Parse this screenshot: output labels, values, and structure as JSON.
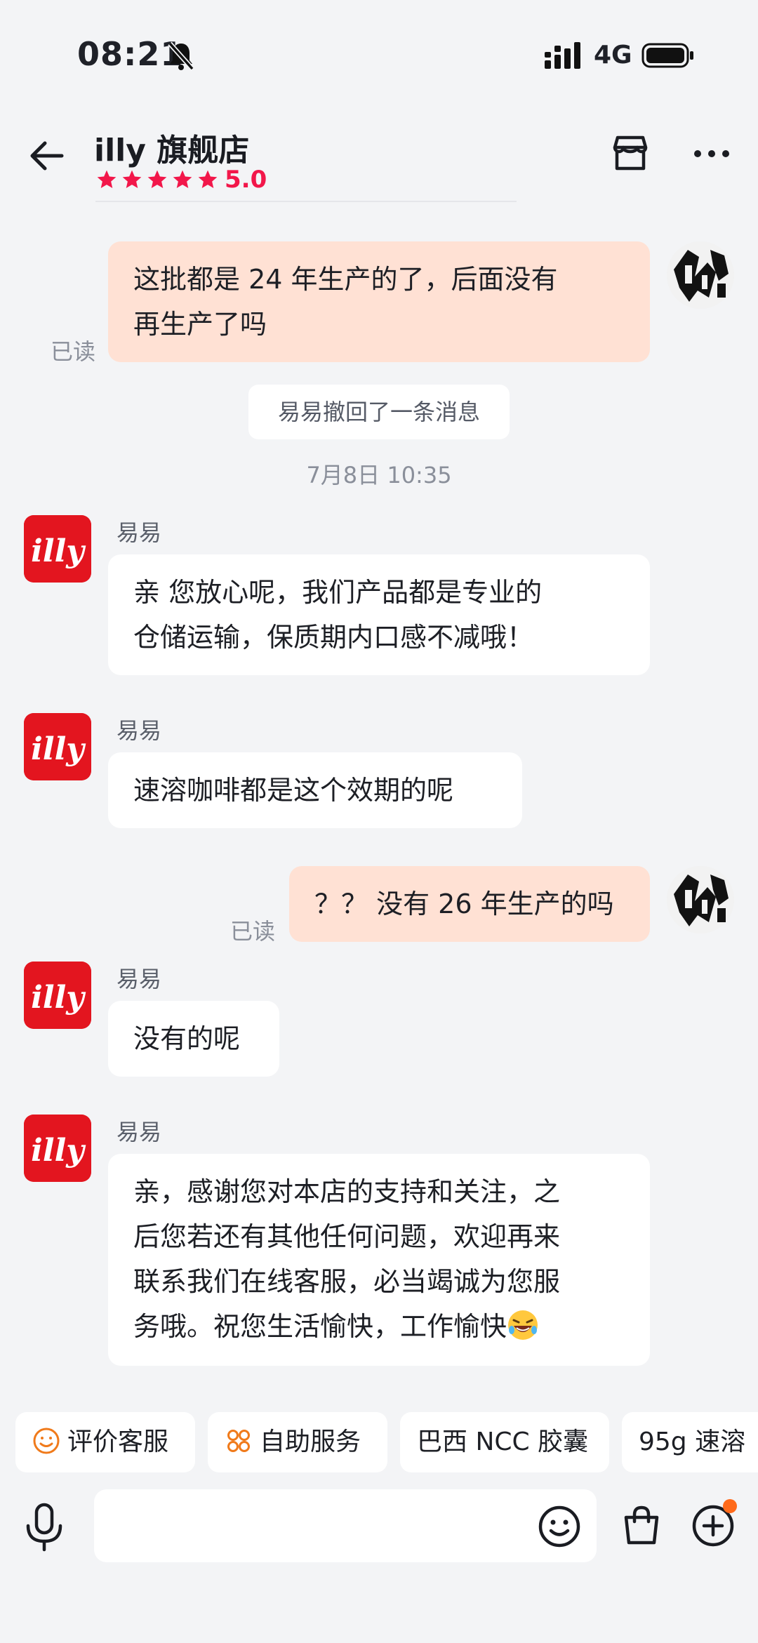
{
  "status_bar": {
    "time": "08:21",
    "network": "4G"
  },
  "header": {
    "shop_name": "illy 旗舰店",
    "rating": "5.0"
  },
  "messages": [
    {
      "read": "已读",
      "text_line1": "这批都是 24 年生产的了，后面没有",
      "text_line2": "再生产了吗"
    },
    {
      "system": "易易撤回了一条消息"
    },
    {
      "timestamp": "7月8日 10:35"
    },
    {
      "sender": "易易",
      "text_line1": "亲 您放心呢，我们产品都是专业的",
      "text_line2": "仓储运输，保质期内口感不减哦！"
    },
    {
      "sender": "易易",
      "text": "速溶咖啡都是这个效期的呢"
    },
    {
      "read": "已读",
      "text": "？？ 没有 26 年生产的吗"
    },
    {
      "sender": "易易",
      "text": "没有的呢"
    },
    {
      "sender": "易易",
      "text_line1": "亲，感谢您对本店的支持和关注，之",
      "text_line2": "后您若还有其他任何问题，欢迎再来",
      "text_line3": "联系我们在线客服，必当竭诚为您服",
      "text_line4": "务哦。祝您生活愉快，工作愉快"
    }
  ],
  "quick_chips": [
    "评价客服",
    "自助服务",
    "巴西 NCC 胶囊",
    "95g 速溶"
  ],
  "shop_logo_text": "illy",
  "colors": {
    "accent": "#f2174a",
    "my_bubble": "#ffe1d4",
    "brand_red": "#e3151f",
    "badge": "#ff6a1a"
  }
}
